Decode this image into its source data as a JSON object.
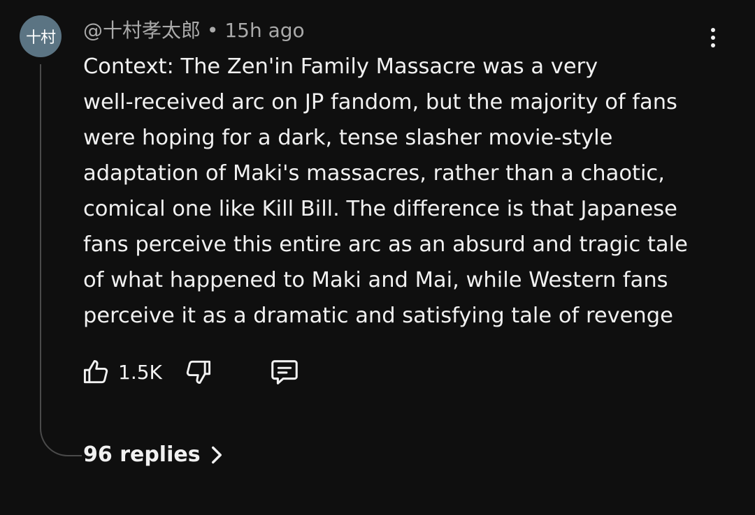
{
  "avatar": {
    "text": "十村",
    "color": "#5b7483"
  },
  "comment": {
    "author": "@十村孝太郎",
    "separator": "•",
    "timestamp": "15h ago",
    "lines": [
      "Context: The Zen'in Family Massacre was a very",
      "well-received arc on JP fandom, but the majority of fans",
      "were hoping for a dark, tense slasher movie-style",
      "adaptation of Maki's massacres, rather than a chaotic,",
      "comical one like Kill Bill. The difference is that Japanese",
      "fans perceive this entire arc as an absurd and tragic tale",
      "of what happened to Maki and Mai, while Western fans",
      "perceive it as a dramatic and satisfying tale of revenge"
    ]
  },
  "actions": {
    "like_icon": "thumbs-up-icon",
    "like_count": "1.5K",
    "dislike_icon": "thumbs-down-icon",
    "reply_icon": "comment-icon"
  },
  "replies": {
    "label": "96 replies",
    "icon": "chevron-right-icon"
  },
  "more_icon": "more-vertical-icon"
}
